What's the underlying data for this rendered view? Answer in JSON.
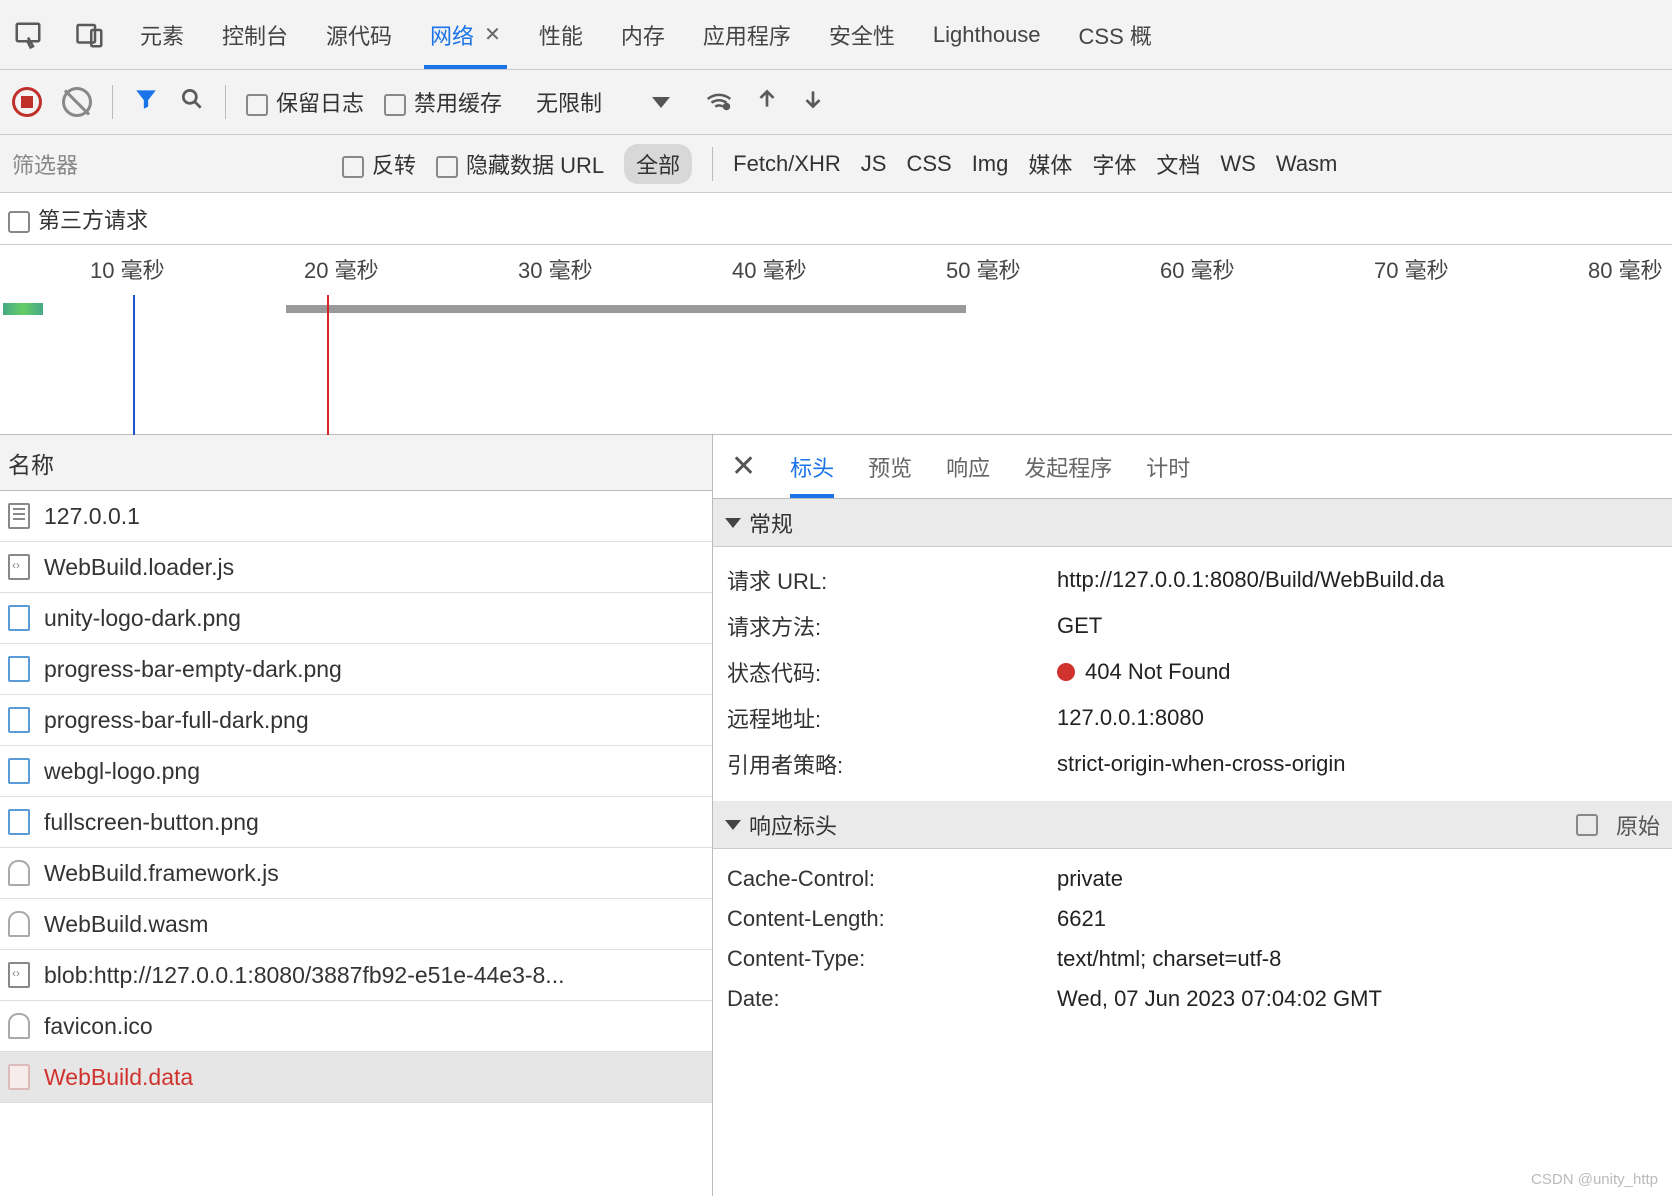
{
  "tabs": {
    "items": [
      "元素",
      "控制台",
      "源代码",
      "网络",
      "性能",
      "内存",
      "应用程序",
      "安全性",
      "Lighthouse",
      "CSS 概"
    ],
    "active_index": 3
  },
  "toolbar": {
    "preserve_log": "保留日志",
    "disable_cache": "禁用缓存",
    "throttling": "无限制"
  },
  "filter": {
    "placeholder": "筛选器",
    "invert": "反转",
    "hide_data_urls": "隐藏数据 URL",
    "types": [
      "全部",
      "Fetch/XHR",
      "JS",
      "CSS",
      "Img",
      "媒体",
      "字体",
      "文档",
      "WS",
      "Wasm"
    ],
    "active_type_index": 0,
    "third_party": "第三方请求"
  },
  "timeline": {
    "unit": "毫秒",
    "ticks": [
      10,
      20,
      30,
      40,
      50,
      60,
      70,
      80
    ]
  },
  "requests": {
    "header": "名称",
    "list": [
      {
        "icon": "doc",
        "name": "127.0.0.1"
      },
      {
        "icon": "js",
        "name": "WebBuild.loader.js"
      },
      {
        "icon": "img",
        "name": "unity-logo-dark.png"
      },
      {
        "icon": "img",
        "name": "progress-bar-empty-dark.png"
      },
      {
        "icon": "img",
        "name": "progress-bar-full-dark.png"
      },
      {
        "icon": "img",
        "name": "webgl-logo.png"
      },
      {
        "icon": "img",
        "name": "fullscreen-button.png"
      },
      {
        "icon": "unk",
        "name": "WebBuild.framework.js"
      },
      {
        "icon": "unk",
        "name": "WebBuild.wasm"
      },
      {
        "icon": "js",
        "name": "blob:http://127.0.0.1:8080/3887fb92-e51e-44e3-8..."
      },
      {
        "icon": "unk",
        "name": "favicon.ico"
      },
      {
        "icon": "err",
        "name": "WebBuild.data",
        "error": true,
        "selected": true
      }
    ]
  },
  "details": {
    "tabs": [
      "标头",
      "预览",
      "响应",
      "发起程序",
      "计时"
    ],
    "active_index": 0,
    "general": {
      "title": "常规",
      "items": {
        "request_url_k": "请求 URL:",
        "request_url_v": "http://127.0.0.1:8080/Build/WebBuild.da",
        "method_k": "请求方法:",
        "method_v": "GET",
        "status_k": "状态代码:",
        "status_v": "404 Not Found",
        "remote_k": "远程地址:",
        "remote_v": "127.0.0.1:8080",
        "referrer_k": "引用者策略:",
        "referrer_v": "strict-origin-when-cross-origin"
      }
    },
    "response_headers": {
      "title": "响应标头",
      "raw_label": "原始",
      "items": {
        "cc_k": "Cache-Control:",
        "cc_v": "private",
        "cl_k": "Content-Length:",
        "cl_v": "6621",
        "ct_k": "Content-Type:",
        "ct_v": "text/html; charset=utf-8",
        "dt_k": "Date:",
        "dt_v": "Wed, 07 Jun 2023 07:04:02 GMT"
      }
    }
  },
  "watermark": "CSDN @unity_http"
}
